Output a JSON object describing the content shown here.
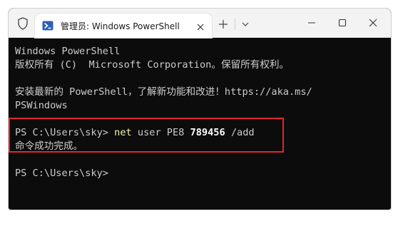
{
  "titlebar": {
    "tab_title": "管理员: Windows PowerShell",
    "icons": {
      "shield": "shield-icon",
      "tab": "powershell-icon",
      "tab_close": "close-icon",
      "new_tab": "plus-icon",
      "dropdown": "chevron-down-icon",
      "minimize": "minimize-icon",
      "maximize": "maximize-icon",
      "close": "close-icon"
    }
  },
  "console": {
    "line1": "Windows PowerShell",
    "line2": "版权所有 (C)  Microsoft Corporation。保留所有权利。",
    "line3": "安装最新的 PowerShell，了解新功能和改进！https://aka.ms/",
    "line4": "PSWindows",
    "command": {
      "prompt": "PS C:\\Users\\sky> ",
      "cmd": "net",
      "arg1": " user PE8 ",
      "num": "789456",
      "arg2": " /add"
    },
    "result": "命令成功完成。",
    "prompt2": "PS C:\\Users\\sky>"
  },
  "colors": {
    "console_bg": "#0c0c0c",
    "console_text": "#cccccc",
    "command_yellow": "#f9f1a5",
    "highlight_red": "#e0262b",
    "titlebar_bg": "#f3f3f3"
  }
}
